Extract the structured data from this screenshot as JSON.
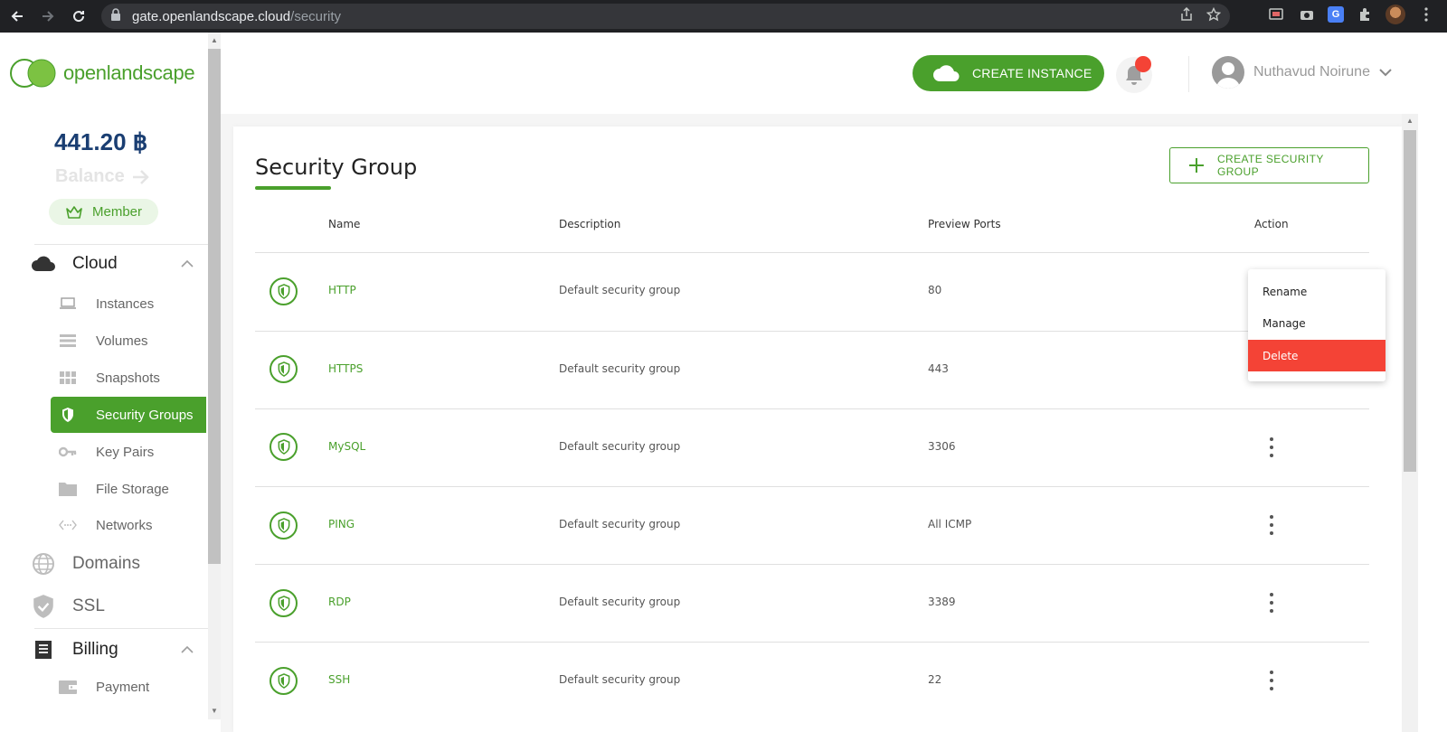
{
  "browser": {
    "url_host": "gate.openlandscape.cloud",
    "url_path": "/security"
  },
  "brand": {
    "logo_text": "openlandscape",
    "accent": "#4aa02c"
  },
  "account": {
    "balance": "441.20 ฿",
    "balance_label": "Balance",
    "member_label": "Member"
  },
  "sidebar": {
    "cloud_label": "Cloud",
    "cloud_items": [
      {
        "label": "Instances",
        "icon": "laptop-icon"
      },
      {
        "label": "Volumes",
        "icon": "volumes-icon"
      },
      {
        "label": "Snapshots",
        "icon": "grid-icon"
      },
      {
        "label": "Security Groups",
        "icon": "shield-icon",
        "active": true
      },
      {
        "label": "Key Pairs",
        "icon": "key-icon"
      },
      {
        "label": "File Storage",
        "icon": "folder-icon"
      },
      {
        "label": "Networks",
        "icon": "network-icon"
      }
    ],
    "domains_label": "Domains",
    "ssl_label": "SSL",
    "billing_label": "Billing",
    "billing_items": [
      {
        "label": "Payment",
        "icon": "wallet-icon"
      }
    ]
  },
  "header": {
    "create_instance": "CREATE INSTANCE",
    "user_name": "Nuthavud Noirune"
  },
  "main": {
    "title": "Security Group",
    "create_button": "CREATE SECURITY GROUP",
    "columns": [
      "Name",
      "Description",
      "Preview Ports",
      "Action"
    ],
    "rows": [
      {
        "name": "HTTP",
        "description": "Default security group",
        "ports": "80"
      },
      {
        "name": "HTTPS",
        "description": "Default security group",
        "ports": "443"
      },
      {
        "name": "MySQL",
        "description": "Default security group",
        "ports": "3306"
      },
      {
        "name": "PING",
        "description": "Default security group",
        "ports": "All ICMP"
      },
      {
        "name": "RDP",
        "description": "Default security group",
        "ports": "3389"
      },
      {
        "name": "SSH",
        "description": "Default security group",
        "ports": "22"
      }
    ],
    "action_menu": [
      "Rename",
      "Manage",
      "Delete"
    ]
  }
}
